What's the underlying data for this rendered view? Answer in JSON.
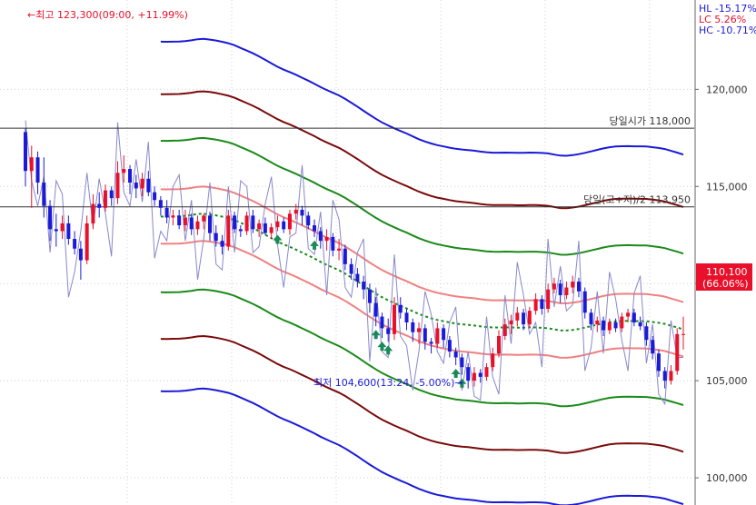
{
  "chart_data": {
    "type": "candlestick",
    "y_axis": {
      "min": 98600,
      "max": 124600,
      "ticks": [
        100000,
        105000,
        110000,
        115000,
        120000
      ],
      "tick_labels": [
        "100,000",
        "105,000",
        "110,000",
        "115,000",
        "120,000"
      ]
    },
    "candles": {
      "count": 120,
      "up_color": "#e8102a",
      "down_color": "#1a1ad8",
      "ohlc": [
        [
          117800,
          118000,
          115000,
          115800
        ],
        [
          115800,
          117100,
          113900,
          116500
        ],
        [
          116500,
          116800,
          114600,
          115200
        ],
        [
          115200,
          116500,
          113400,
          114000
        ],
        [
          114000,
          114300,
          112200,
          112800
        ],
        [
          112800,
          113600,
          111900,
          112700
        ],
        [
          112700,
          113500,
          112300,
          113100
        ],
        [
          113100,
          113500,
          112000,
          112300
        ],
        [
          112300,
          112700,
          111500,
          111800
        ],
        [
          111800,
          112200,
          110200,
          111200
        ],
        [
          111200,
          113500,
          111000,
          113100
        ],
        [
          113100,
          114600,
          112800,
          114100
        ],
        [
          114100,
          114700,
          113400,
          113900
        ],
        [
          113900,
          115100,
          113700,
          114800
        ],
        [
          114800,
          115000,
          114000,
          114400
        ],
        [
          114400,
          116300,
          114100,
          115700
        ],
        [
          115700,
          116600,
          115200,
          115900
        ],
        [
          115900,
          116100,
          114600,
          115200
        ],
        [
          115200,
          115600,
          114400,
          114900
        ],
        [
          114900,
          115700,
          114500,
          115400
        ],
        [
          115400,
          115800,
          114500,
          114700
        ],
        [
          114700,
          115000,
          114000,
          114300
        ],
        [
          114300,
          114500,
          113500,
          113900
        ],
        [
          113900,
          114300,
          113100,
          113400
        ],
        [
          113400,
          113800,
          113000,
          113500
        ],
        [
          113500,
          113800,
          112800,
          113000
        ],
        [
          113000,
          113800,
          112700,
          113400
        ],
        [
          113400,
          113600,
          112500,
          112800
        ],
        [
          112800,
          113500,
          112500,
          113200
        ],
        [
          113200,
          113600,
          112800,
          113500
        ],
        [
          113500,
          113700,
          112200,
          112600
        ],
        [
          112600,
          113000,
          111900,
          112200
        ],
        [
          112200,
          112500,
          111500,
          111900
        ],
        [
          111900,
          113800,
          111700,
          113500
        ],
        [
          113500,
          113700,
          112600,
          112800
        ],
        [
          112800,
          113000,
          112400,
          112700
        ],
        [
          112700,
          113700,
          112500,
          113500
        ],
        [
          113500,
          113800,
          112600,
          112800
        ],
        [
          112800,
          113300,
          112400,
          113100
        ],
        [
          113100,
          113400,
          112500,
          112600
        ],
        [
          112600,
          113100,
          112300,
          112900
        ],
        [
          112900,
          113500,
          112700,
          113200
        ],
        [
          113200,
          113400,
          112600,
          112800
        ],
        [
          112800,
          113800,
          112500,
          113600
        ],
        [
          113600,
          114100,
          113300,
          113800
        ],
        [
          113800,
          114000,
          113000,
          113500
        ],
        [
          113500,
          113700,
          112800,
          113000
        ],
        [
          113000,
          113300,
          112400,
          112700
        ],
        [
          112700,
          112900,
          111800,
          112200
        ],
        [
          112200,
          112800,
          111700,
          112400
        ],
        [
          112400,
          112600,
          111400,
          111700
        ],
        [
          111700,
          112300,
          111200,
          111800
        ],
        [
          111800,
          112000,
          110700,
          111000
        ],
        [
          111000,
          111300,
          110200,
          110500
        ],
        [
          110500,
          110800,
          109800,
          110100
        ],
        [
          110100,
          110400,
          109200,
          109700
        ],
        [
          109700,
          110000,
          108500,
          109000
        ],
        [
          109000,
          109300,
          107800,
          108300
        ],
        [
          108300,
          108500,
          107200,
          107700
        ],
        [
          107700,
          108200,
          107000,
          107400
        ],
        [
          107400,
          109300,
          107100,
          108900
        ],
        [
          108900,
          109300,
          108200,
          108500
        ],
        [
          108500,
          108700,
          107600,
          108000
        ],
        [
          108000,
          108200,
          107000,
          107500
        ],
        [
          107500,
          108000,
          106900,
          107700
        ],
        [
          107700,
          107900,
          106600,
          107000
        ],
        [
          107000,
          107200,
          106400,
          106900
        ],
        [
          106900,
          108000,
          106700,
          107700
        ],
        [
          107700,
          107900,
          106700,
          107100
        ],
        [
          107100,
          107300,
          106200,
          106500
        ],
        [
          106500,
          106700,
          105800,
          106200
        ],
        [
          106200,
          106400,
          105300,
          105700
        ],
        [
          105700,
          105900,
          104600,
          105000
        ],
        [
          105000,
          105700,
          104700,
          105400
        ],
        [
          105400,
          105600,
          104900,
          105200
        ],
        [
          105200,
          105900,
          105000,
          105700
        ],
        [
          105700,
          106700,
          105500,
          106400
        ],
        [
          106400,
          107600,
          106200,
          107300
        ],
        [
          107300,
          108200,
          107100,
          107900
        ],
        [
          107900,
          108400,
          107400,
          108100
        ],
        [
          108100,
          108800,
          107800,
          108500
        ],
        [
          108500,
          108700,
          107600,
          107900
        ],
        [
          107900,
          108800,
          107700,
          108600
        ],
        [
          108600,
          109500,
          108400,
          109200
        ],
        [
          109200,
          109400,
          108400,
          108700
        ],
        [
          108700,
          110000,
          108500,
          109700
        ],
        [
          109700,
          110300,
          109500,
          110000
        ],
        [
          110000,
          110200,
          109000,
          109400
        ],
        [
          109400,
          110100,
          109200,
          109800
        ],
        [
          109800,
          110400,
          109500,
          110100
        ],
        [
          110100,
          110300,
          109300,
          109600
        ],
        [
          109600,
          109800,
          108200,
          108500
        ],
        [
          108500,
          108700,
          107600,
          107900
        ],
        [
          107900,
          108300,
          107500,
          108100
        ],
        [
          108100,
          108300,
          107300,
          107600
        ],
        [
          107600,
          108200,
          107400,
          108000
        ],
        [
          108000,
          108200,
          107500,
          107700
        ],
        [
          107700,
          108500,
          107500,
          108300
        ],
        [
          108300,
          108700,
          108000,
          108500
        ],
        [
          108500,
          108700,
          107800,
          108000
        ],
        [
          108000,
          108300,
          107600,
          107800
        ],
        [
          107800,
          108000,
          106800,
          107100
        ],
        [
          107100,
          107300,
          106100,
          106400
        ],
        [
          106400,
          106600,
          105200,
          105500
        ],
        [
          105500,
          105700,
          104600,
          105000
        ],
        [
          105000,
          105800,
          104800,
          105500
        ],
        [
          105500,
          107700,
          105300,
          107400
        ],
        [
          107400,
          108300,
          106600,
          107400
        ]
      ]
    },
    "envelope_bands": [
      {
        "color": "#1a1ad8",
        "role": "outer-upper"
      },
      {
        "color": "#7a0a0a",
        "role": "upper-2"
      },
      {
        "color": "#1a8a1a",
        "role": "upper-1"
      },
      {
        "color": "#f08080",
        "role": "upper-0"
      },
      {
        "color": "#1a8a1a",
        "role": "mid",
        "style": "dotted"
      },
      {
        "color": "#f08080",
        "role": "lower-0"
      },
      {
        "color": "#1a8a1a",
        "role": "lower-1"
      },
      {
        "color": "#7a0a0a",
        "role": "lower-2"
      },
      {
        "color": "#1a1ad8",
        "role": "outer-lower"
      }
    ],
    "h_lines": [
      {
        "label": "당일시가 118,000",
        "value": 118000
      },
      {
        "label": "당일(고+저)/2 113,950",
        "value": 113950
      }
    ],
    "annotations": {
      "high_label": "←최고 123,300(09:00, +11.99%)",
      "low_label": "최저 104,600(13:24, -5.00%)→",
      "top_right_lines": [
        {
          "text": "HL -15.17%",
          "color": "#1a1ad8"
        },
        {
          "text": "LC  5.26%",
          "color": "#e8102a"
        },
        {
          "text": "HC -10.71%",
          "color": "#1a1ad8"
        }
      ],
      "current_price": "110,100",
      "current_pct": "(66.06%)"
    },
    "colors": {
      "up": "#e8102a",
      "down": "#1a1ad8",
      "thin_line": "#8888cc",
      "grid": "#d0d0d0",
      "hline": "#333333",
      "price_badge": "#e8102a"
    }
  }
}
